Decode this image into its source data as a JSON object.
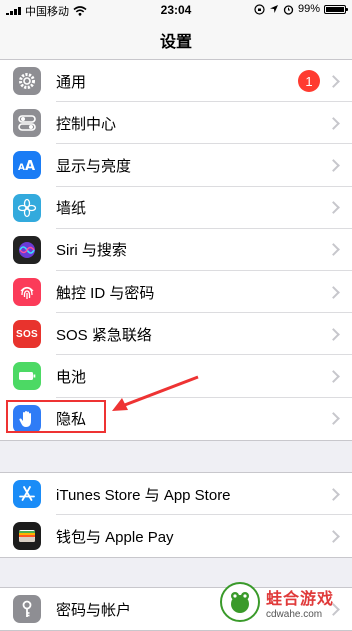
{
  "status": {
    "carrier": "中国移动",
    "time": "23:04",
    "battery": "99%",
    "battery_level": 0.99
  },
  "nav": {
    "title": "设置"
  },
  "groups": [
    [
      {
        "label": "通用",
        "icon": "gear-icon",
        "color": "#8e8e93",
        "badge": "1"
      },
      {
        "label": "控制中心",
        "icon": "toggles-icon",
        "color": "#8e8e93"
      },
      {
        "label": "显示与亮度",
        "icon": "text-size-icon",
        "color": "#1a7cf5"
      },
      {
        "label": "墙纸",
        "icon": "flower-icon",
        "color": "#33aadd"
      },
      {
        "label": "Siri 与搜索",
        "icon": "siri-icon",
        "color": "#222222"
      },
      {
        "label": "触控 ID 与密码",
        "icon": "fingerprint-icon",
        "color": "#fb3b59"
      },
      {
        "label": "SOS 紧急联络",
        "icon": "sos-icon",
        "color": "#e8332d"
      },
      {
        "label": "电池",
        "icon": "battery-icon",
        "color": "#4cd964"
      },
      {
        "label": "隐私",
        "icon": "hand-icon",
        "color": "#2f7cf6"
      }
    ],
    [
      {
        "label": "iTunes Store 与 App Store",
        "icon": "app-store-icon",
        "color": "#1a8cf7"
      },
      {
        "label": "钱包与 Apple Pay",
        "icon": "wallet-icon",
        "color": "#1c1c1c"
      }
    ],
    [
      {
        "label": "密码与帐户",
        "icon": "key-icon",
        "color": "#8e8e93"
      }
    ]
  ],
  "watermark": {
    "title": "蛙合游戏",
    "url": "cdwahe.com"
  }
}
